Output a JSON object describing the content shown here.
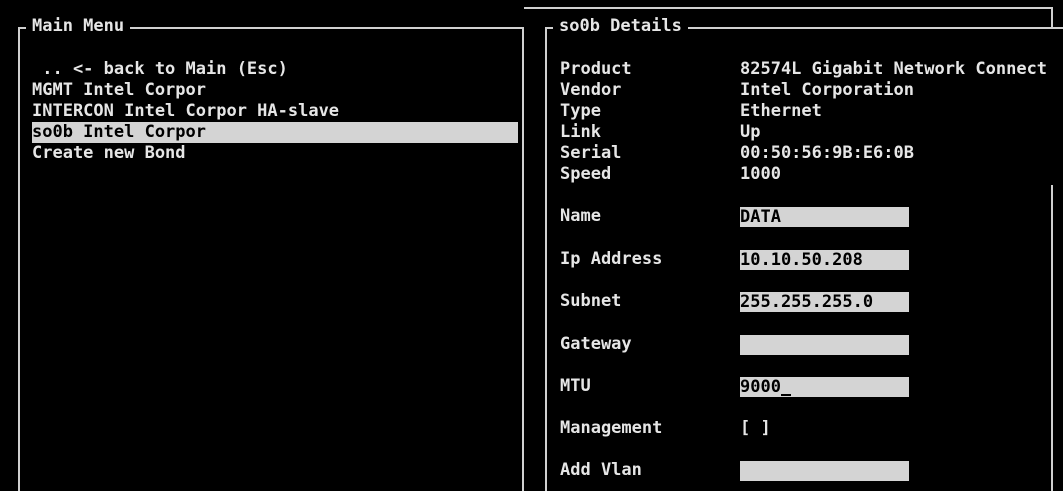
{
  "main_menu": {
    "title": "Main Menu",
    "items": [
      {
        "label": " .. <- back to Main (Esc)",
        "selected": false
      },
      {
        "label": "MGMT Intel Corpor",
        "selected": false
      },
      {
        "label": "INTERCON Intel Corpor HA-slave",
        "selected": false
      },
      {
        "label": "so0b Intel Corpor",
        "selected": true
      },
      {
        "label": "Create new Bond",
        "selected": false
      }
    ]
  },
  "details": {
    "title": "so0b Details",
    "info": [
      {
        "label": "Product",
        "value": "82574L Gigabit Network Connect"
      },
      {
        "label": "Vendor",
        "value": "Intel Corporation"
      },
      {
        "label": "Type",
        "value": "Ethernet"
      },
      {
        "label": "Link",
        "value": "Up"
      },
      {
        "label": "Serial",
        "value": "00:50:56:9B:E6:0B"
      },
      {
        "label": "Speed",
        "value": "1000"
      }
    ],
    "form": {
      "name_label": "Name",
      "name_value": "DATA",
      "ip_label": "Ip Address",
      "ip_value": "10.10.50.208",
      "subnet_label": "Subnet",
      "subnet_value": "255.255.255.0",
      "gateway_label": "Gateway",
      "gateway_value": "",
      "mtu_label": "MTU",
      "mtu_value": "9000",
      "management_label": "Management",
      "management_checkbox": "[ ]",
      "vlan_label": "Add Vlan",
      "vlan_value": ""
    }
  }
}
